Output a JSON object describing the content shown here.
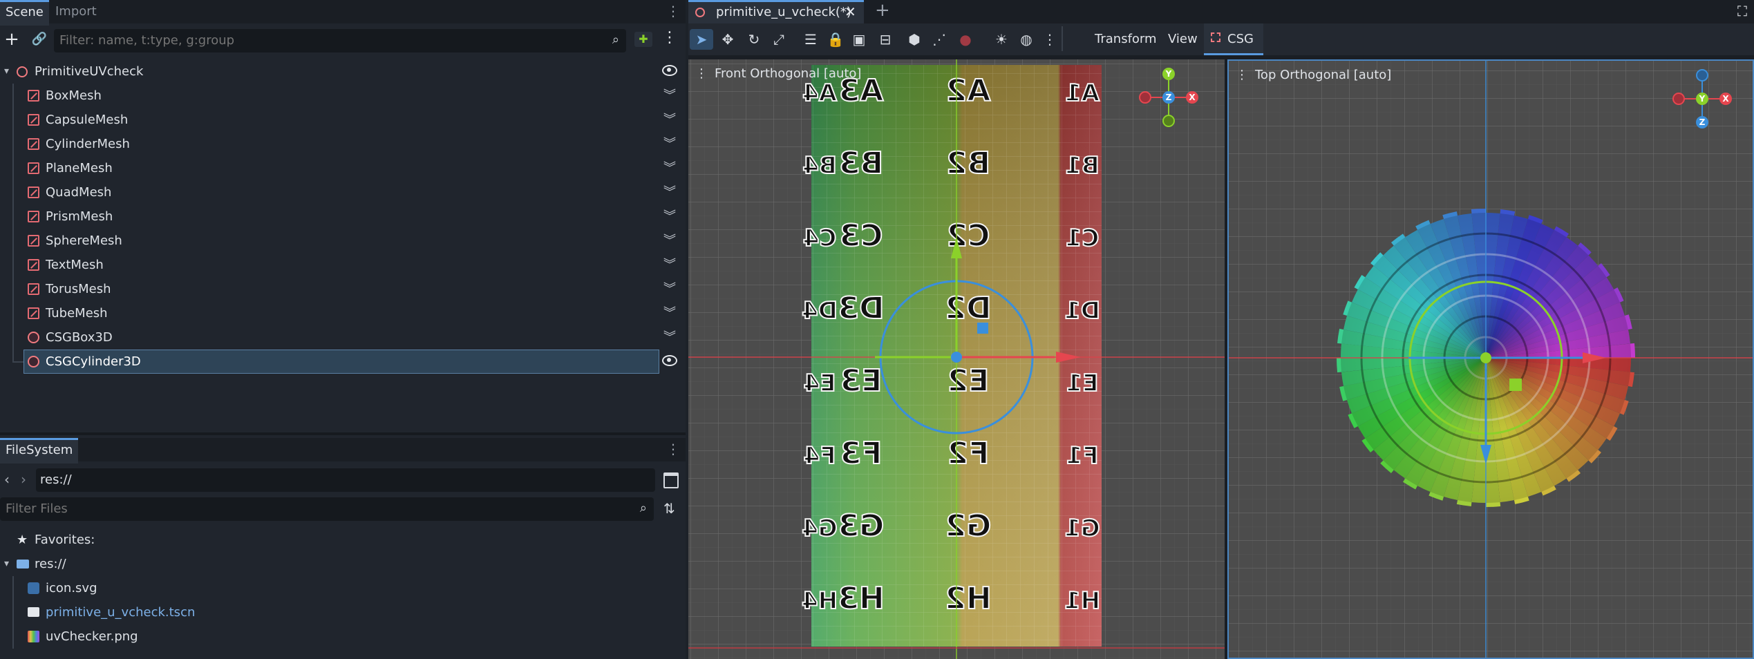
{
  "scene_dock": {
    "tabs": [
      "Scene",
      "Import"
    ],
    "filter_placeholder": "Filter: name, t:type, g:group",
    "tree": [
      {
        "label": "PrimitiveUVcheck",
        "icon": "node3d-icon",
        "visible": true
      },
      {
        "label": "BoxMesh",
        "icon": "meshinstance-icon"
      },
      {
        "label": "CapsuleMesh",
        "icon": "meshinstance-icon"
      },
      {
        "label": "CylinderMesh",
        "icon": "meshinstance-icon"
      },
      {
        "label": "PlaneMesh",
        "icon": "meshinstance-icon"
      },
      {
        "label": "QuadMesh",
        "icon": "meshinstance-icon"
      },
      {
        "label": "PrismMesh",
        "icon": "meshinstance-icon"
      },
      {
        "label": "SphereMesh",
        "icon": "meshinstance-icon"
      },
      {
        "label": "TextMesh",
        "icon": "meshinstance-icon"
      },
      {
        "label": "TorusMesh",
        "icon": "meshinstance-icon"
      },
      {
        "label": "TubeMesh",
        "icon": "meshinstance-icon"
      },
      {
        "label": "CSGBox3D",
        "icon": "csgbox-icon"
      },
      {
        "label": "CSGCylinder3D",
        "icon": "csgcylinder-icon",
        "selected": true,
        "visible": true
      }
    ]
  },
  "filesystem_dock": {
    "tab": "FileSystem",
    "path": "res://",
    "filter_placeholder": "Filter Files",
    "favorites_label": "Favorites:",
    "root_label": "res://",
    "files": [
      {
        "label": "icon.svg",
        "icon": "svg-file-icon"
      },
      {
        "label": "primitive_u_vcheck.tscn",
        "icon": "scene-file-icon",
        "highlight": true
      },
      {
        "label": "uvChecker.png",
        "icon": "image-file-icon"
      }
    ]
  },
  "editor": {
    "scene_tab": "primitive_u_vcheck(*)",
    "menus": {
      "transform": "Transform",
      "view": "View",
      "csg": "CSG"
    },
    "viewports": {
      "front": {
        "label": "Front Orthogonal [auto]"
      },
      "top": {
        "label": "Top Orthogonal [auto]"
      }
    },
    "gizmo_axes": {
      "x": "X",
      "y": "Y",
      "z": "Z"
    },
    "uv_rows": [
      "A",
      "B",
      "C",
      "D",
      "E",
      "F",
      "G",
      "H"
    ],
    "uv_cols": [
      "4",
      "3",
      "2",
      "1"
    ]
  },
  "colors": {
    "accent": "#5a9be0",
    "axis_x": "#e5464f",
    "axis_y": "#8bd12a",
    "axis_z": "#3a8fdc",
    "selection": "#2e4457"
  }
}
